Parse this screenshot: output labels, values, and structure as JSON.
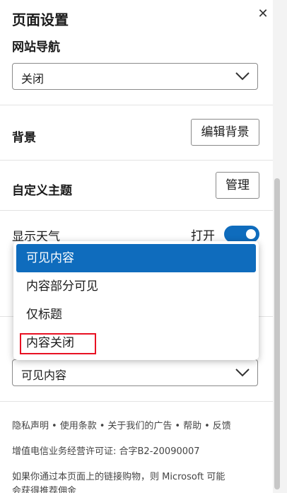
{
  "panel": {
    "title": "页面设置",
    "close_glyph": "✕"
  },
  "site_nav": {
    "label": "网站导航",
    "selected": "关闭"
  },
  "background": {
    "label": "背景",
    "button": "编辑背景"
  },
  "theme": {
    "label": "自定义主题",
    "button": "管理"
  },
  "weather": {
    "label": "显示天气",
    "state_text": "打开"
  },
  "content_dropdown": {
    "options": [
      "可见内容",
      "内容部分可见",
      "仅标题",
      "内容关闭"
    ],
    "highlighted_option": "可见内容",
    "boxed_option": "内容关闭",
    "selected": "可见内容"
  },
  "footer": {
    "links": [
      "隐私声明",
      "使用条款",
      "关于我们的广告",
      "帮助",
      "反馈"
    ],
    "separator": "•",
    "license": "增值电信业务经营许可证: 合字B2-20090007",
    "disclaimer": "如果你通过本页面上的链接购物，则 Microsoft 可能",
    "disclaimer_cut": "会获得推荐佣金"
  },
  "colors": {
    "accent": "#0f6cbd",
    "highlight_border": "#e81123"
  }
}
